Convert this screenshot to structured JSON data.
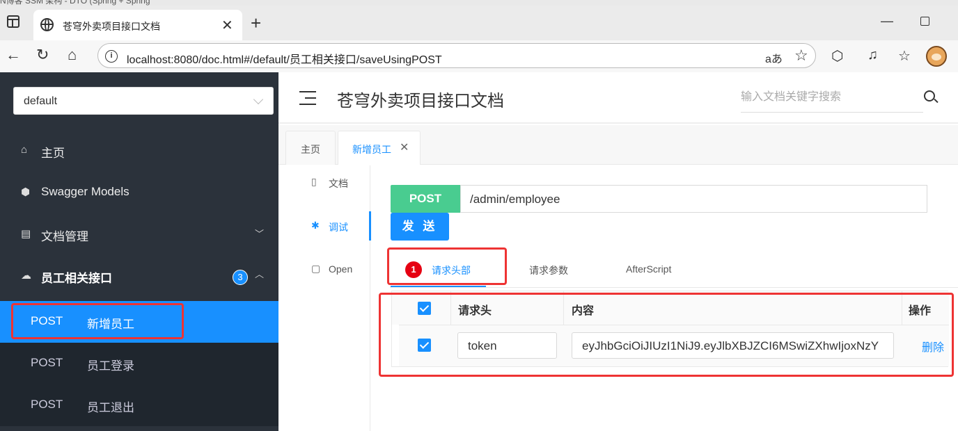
{
  "browser": {
    "tab_title": "苍穹外卖项目接口文档",
    "url": "localhost:8080/doc.html#/default/员工相关接口/saveUsingPOST",
    "read_aloud_label": "aあ",
    "bg_tab_text": "N博客 SSM 架构 - DTO (Spring + Spring"
  },
  "sidebar": {
    "group_select": "default",
    "items": [
      {
        "label": "主页",
        "icon": "home-icon"
      },
      {
        "label": "Swagger Models",
        "icon": "cube-icon"
      },
      {
        "label": "文档管理",
        "icon": "doc-manage-icon"
      },
      {
        "label": "员工相关接口",
        "icon": "cloud-icon",
        "badge": "3"
      }
    ],
    "sub_items": [
      {
        "method": "POST",
        "name": "新增员工",
        "active": true
      },
      {
        "method": "POST",
        "name": "员工登录",
        "active": false
      },
      {
        "method": "POST",
        "name": "员工退出",
        "active": false
      }
    ]
  },
  "header": {
    "title": "苍穹外卖项目接口文档",
    "search_placeholder": "输入文档关键字搜索"
  },
  "content_tabs": [
    {
      "label": "主页"
    },
    {
      "label": "新增员工"
    }
  ],
  "side_tabs": [
    {
      "label": "文档",
      "icon": "document-icon"
    },
    {
      "label": "调试",
      "icon": "bug-icon"
    },
    {
      "label": "Open",
      "icon": "file-icon"
    }
  ],
  "request": {
    "method": "POST",
    "path": "/admin/employee",
    "send_label": "发 送"
  },
  "debug_tabs": {
    "marker": "1",
    "items": [
      "请求头部",
      "请求参数",
      "AfterScript"
    ]
  },
  "headers_table": {
    "columns": [
      "请求头",
      "内容",
      "操作"
    ],
    "rows": [
      {
        "key": "token",
        "value": "eyJhbGciOiJIUzI1NiJ9.eyJlbXBJZCI6MSwiZXhwIjoxNzY",
        "action": "删除"
      }
    ]
  },
  "colors": {
    "accent": "#1890ff",
    "post": "#49cc90",
    "sidebar_bg": "#2b323b",
    "annotation": "#e33333"
  }
}
